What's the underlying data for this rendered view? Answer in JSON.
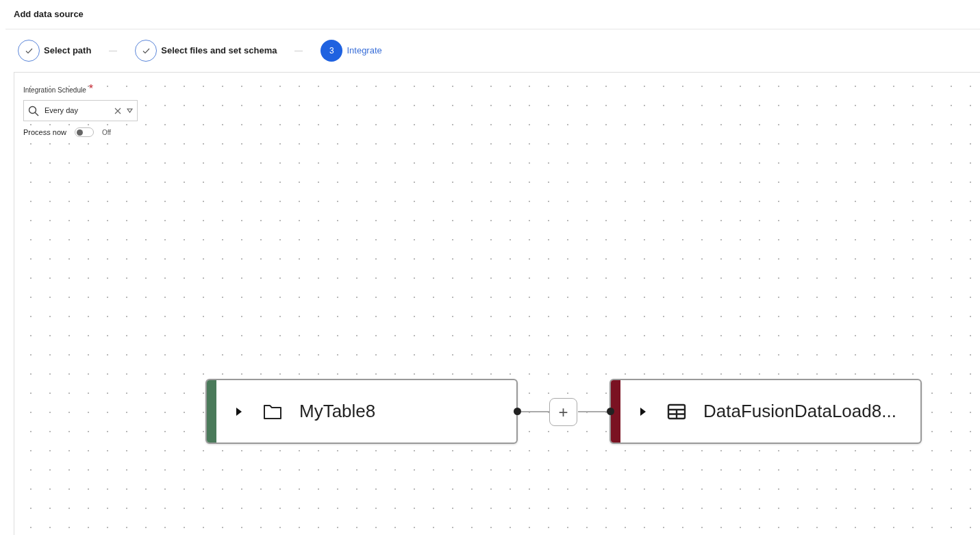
{
  "page": {
    "title": "Add data source"
  },
  "steps": [
    {
      "label": "Select path",
      "completed": true
    },
    {
      "label": "Select files and set schema",
      "completed": true
    },
    {
      "label": "Integrate",
      "completed": false,
      "number": "3"
    }
  ],
  "form": {
    "schedule": {
      "label": "Integration Schedule",
      "required_mark": "*",
      "value": "Every day"
    },
    "process_now": {
      "label": "Process now",
      "on": false,
      "state_text": "Off"
    }
  },
  "pipeline": {
    "nodes": [
      {
        "name": "MyTable8",
        "kind": "folder",
        "color": "#4a7a5a"
      },
      {
        "name": "DataFusionDataLoad8...",
        "kind": "table",
        "color": "#7a1222"
      }
    ],
    "add_button": "+"
  }
}
